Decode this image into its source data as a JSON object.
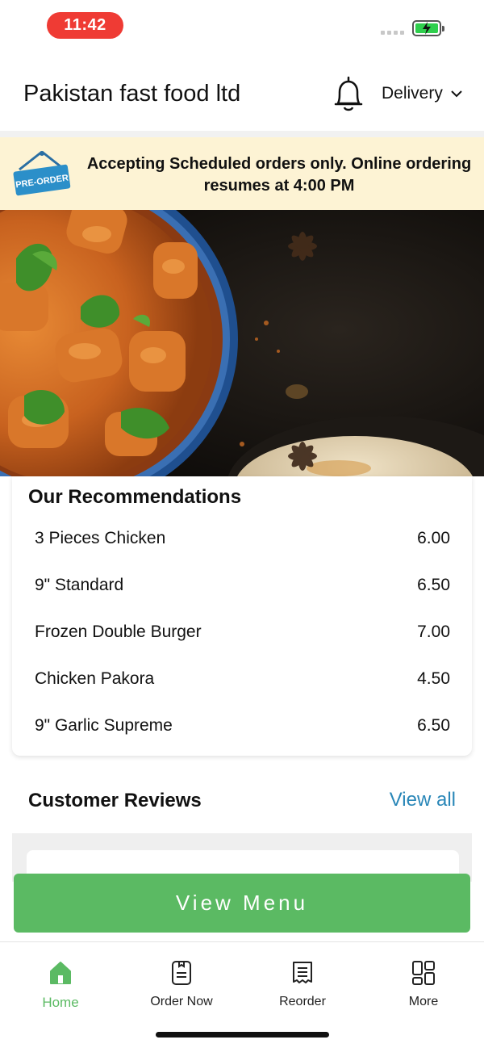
{
  "status_bar": {
    "time": "11:42"
  },
  "header": {
    "store_name": "Pakistan fast food ltd",
    "order_mode": "Delivery"
  },
  "banner": {
    "tag": "PRE-ORDER",
    "message": "Accepting Scheduled orders only. Online ordering resumes at 4:00 PM"
  },
  "recommendations": {
    "title": "Our Recommendations",
    "items": [
      {
        "name": "3 Pieces Chicken",
        "price": "6.00"
      },
      {
        "name": "9\" Standard",
        "price": "6.50"
      },
      {
        "name": "Frozen Double Burger",
        "price": "7.00"
      },
      {
        "name": "Chicken Pakora",
        "price": "4.50"
      },
      {
        "name": "9\" Garlic Supreme",
        "price": "6.50"
      }
    ]
  },
  "reviews": {
    "title": "Customer Reviews",
    "view_all": "View all"
  },
  "view_menu": "View Menu",
  "nav": {
    "items": [
      {
        "label": "Home",
        "icon": "home-icon",
        "active": true
      },
      {
        "label": "Order Now",
        "icon": "order-icon",
        "active": false
      },
      {
        "label": "Reorder",
        "icon": "receipt-icon",
        "active": false
      },
      {
        "label": "More",
        "icon": "grid-icon",
        "active": false
      }
    ]
  },
  "colors": {
    "accent_green": "#5bba63",
    "link_blue": "#2a87b8",
    "banner_bg": "#fdf3d4",
    "time_pill": "#ef3b34"
  }
}
